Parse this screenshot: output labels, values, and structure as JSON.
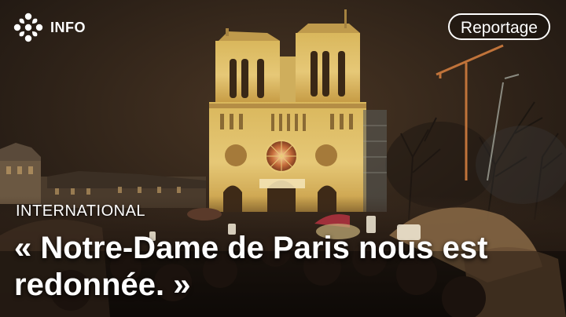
{
  "brand": {
    "logo_icon": "radio-canada-gem-icon",
    "label": "INFO"
  },
  "badge": {
    "label": "Reportage"
  },
  "video": {
    "category": "INTERNATIONAL",
    "headline": "« Notre-Dame de Paris nous est redonnée. »"
  },
  "colors": {
    "text": "#ffffff",
    "facade_light": "#e3c36a",
    "night_sky": "#2a1f17"
  }
}
